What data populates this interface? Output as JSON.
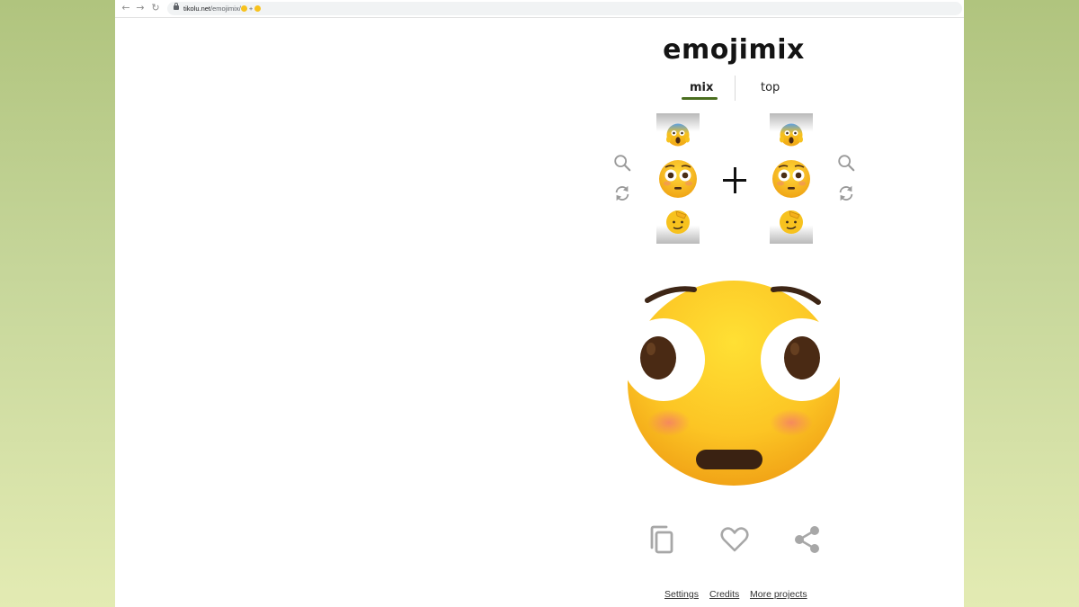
{
  "browser": {
    "url_domain": "tikolu.net",
    "url_path": "/emojimix/",
    "url_suffix": " + "
  },
  "app": {
    "title": "emojimix"
  },
  "tabs": [
    {
      "label": "mix",
      "active": true
    },
    {
      "label": "top",
      "active": false
    }
  ],
  "reels": {
    "left": [
      "face-screaming-in-fear",
      "flushed-face",
      "saluting-face"
    ],
    "right": [
      "face-screaming-in-fear",
      "flushed-face",
      "saluting-face"
    ]
  },
  "operator": "+",
  "result_emoji": "flushed-face-mix",
  "actions": [
    "copy-icon",
    "heart-icon",
    "share-icon"
  ],
  "footer": {
    "settings": "Settings",
    "credits": "Credits",
    "more_projects": "More projects"
  },
  "colors": {
    "accent": "#4a6e1f",
    "emoji_yellow": "#f7c21e",
    "icon_gray": "#9a9a9a"
  }
}
